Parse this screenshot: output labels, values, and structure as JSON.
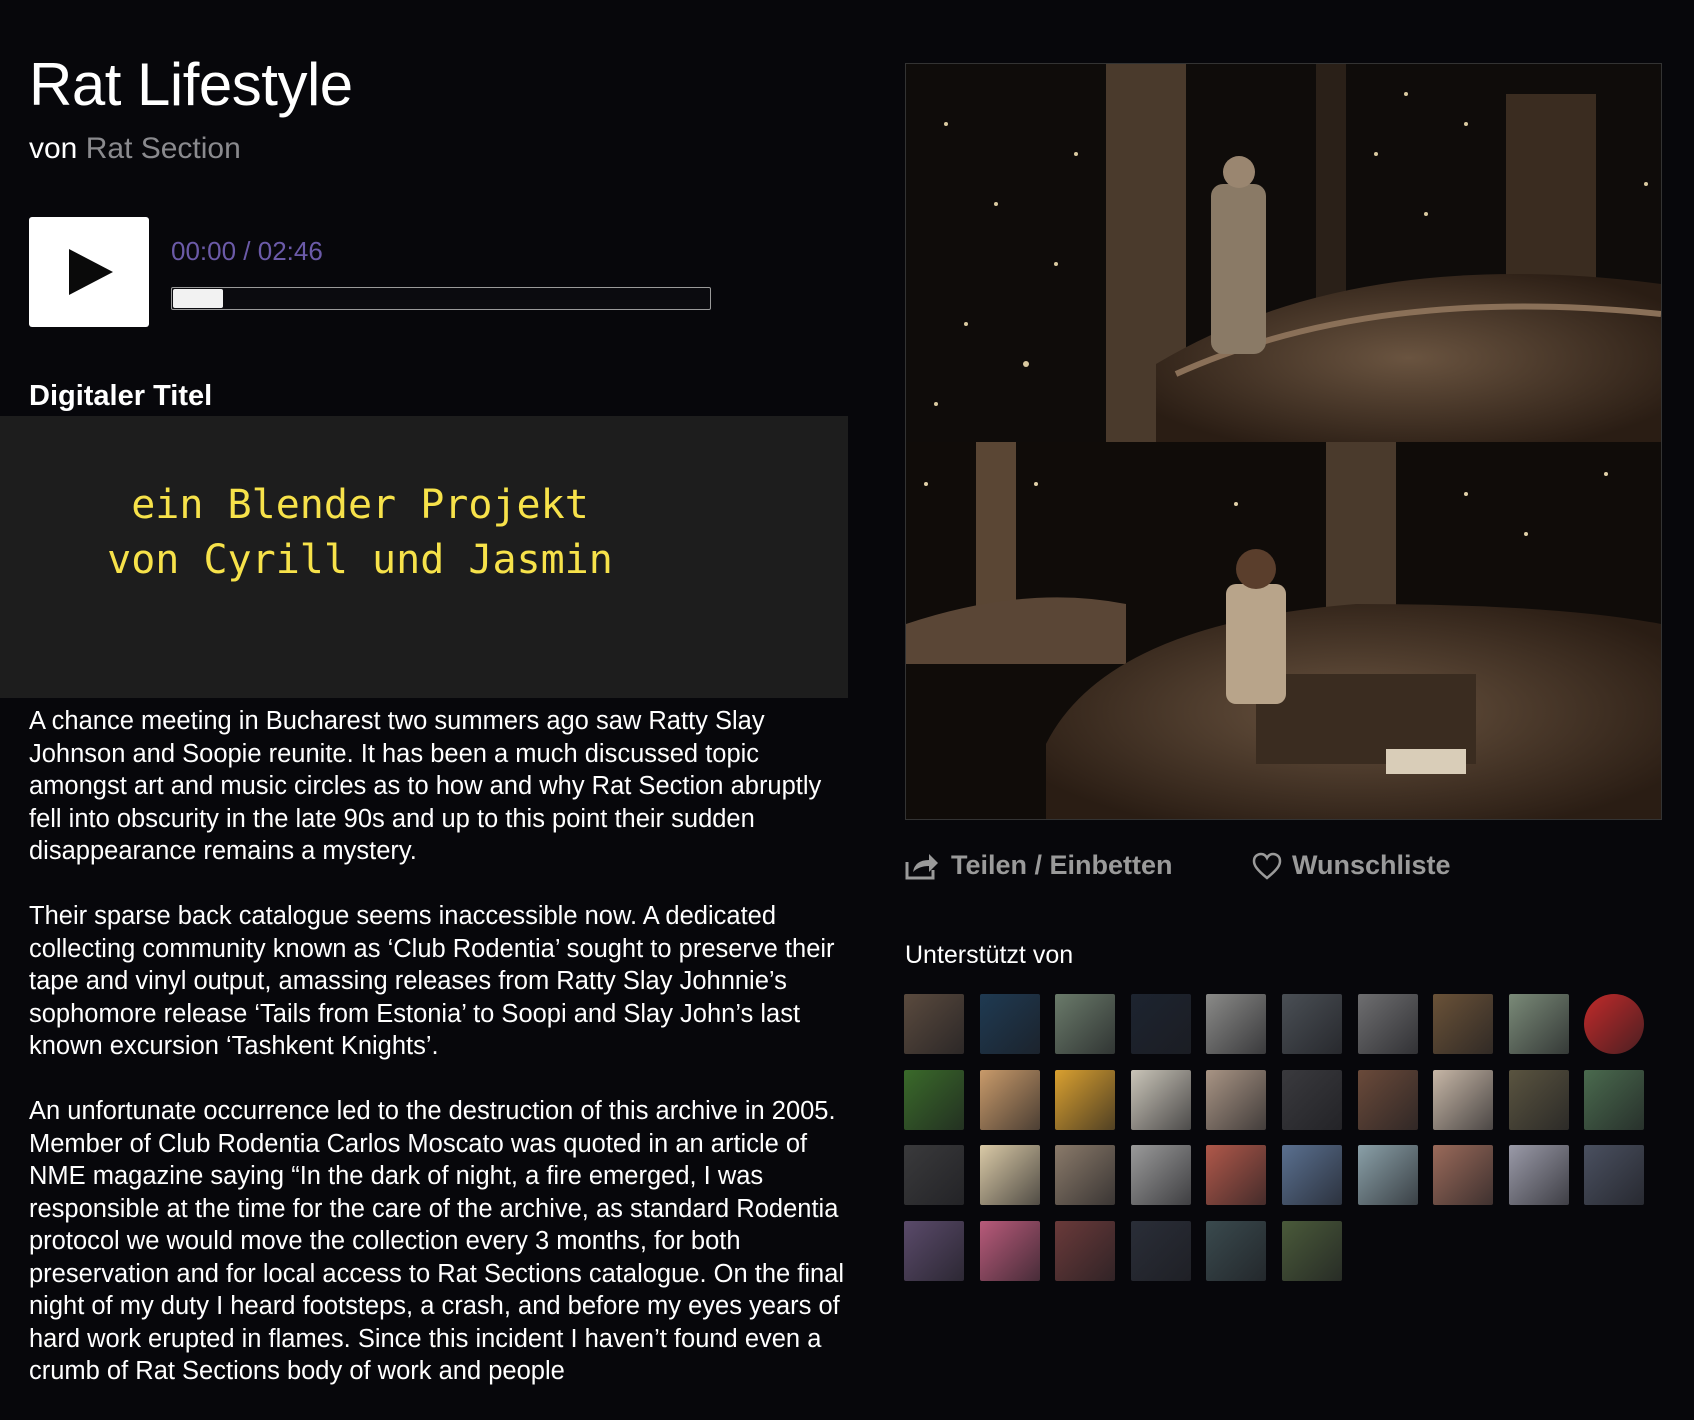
{
  "album": {
    "title": "Rat Lifestyle",
    "by_prefix": "von",
    "artist": "Rat Section"
  },
  "player": {
    "time": "00:00 / 02:46",
    "progress": 0.0
  },
  "track_section": {
    "label": "Digitaler Titel"
  },
  "embed_video": {
    "line1": "ein Blender Projekt",
    "line2": "von Cyrill und Jasmin"
  },
  "description": {
    "p1": "A chance meeting in Bucharest two summers ago saw Ratty Slay Johnson and Soopie reunite. It has been a much discussed topic amongst art and music circles as to how and why Rat Section abruptly fell into obscurity in the late 90s and up to this point their sudden disappearance remains a mystery.",
    "p2": "Their sparse back catalogue seems inaccessible now. A dedicated collecting community known as ‘Club Rodentia’ sought to preserve their tape and vinyl output, amassing releases from Ratty Slay Johnnie’s sophomore release ‘Tails from Estonia’ to Soopi and Slay John’s last known excursion ‘Tashkent Knights’.",
    "p3": "An unfortunate occurrence led to the destruction of this archive in 2005. Member of Club Rodentia Carlos Moscato was quoted in an article of NME magazine saying “In the dark of night, a fire emerged, I was responsible at the time for the care of the archive, as standard Rodentia protocol we would move the collection every 3 months, for both preservation and for local access to Rat Sections catalogue. On the final night of my duty I heard footsteps, a crash, and before my eyes years of hard work erupted in flames. Since this incident I haven’t found even a crumb of Rat Sections body of work and people"
  },
  "actions": {
    "share_label": "Teilen / Einbetten",
    "share_icon": "share-icon",
    "wishlist_label": "Wunschliste",
    "wishlist_icon": "heart-icon"
  },
  "supporters": {
    "label": "Unterstützt von",
    "colors": [
      "#5a4a3e",
      "#1f3a52",
      "#6a7a6a",
      "#1d2430",
      "#8a8a88",
      "#4a4f55",
      "#6e6e70",
      "#6a5238",
      "#7a8a78",
      "#c22a2a",
      "#3a6a2a",
      "#c89a6a",
      "#d9a030",
      "#c9c4b8",
      "#a89484",
      "#3a3a3e",
      "#6a4a3a",
      "#c6b6a6",
      "#5a5440",
      "#4a6a4e",
      "#3a3a3c",
      "#d9c9a6",
      "#8a7a6a",
      "#9a9a9a",
      "#b0584a",
      "#5a7090",
      "#8aa0a8",
      "#9a6a5a",
      "#9a9aa8",
      "#4a5060",
      "#5a4a6a",
      "#b85a7a",
      "#6a3a3a",
      "#2a2e38",
      "#3a4a4e",
      "#4a5a3a"
    ]
  }
}
